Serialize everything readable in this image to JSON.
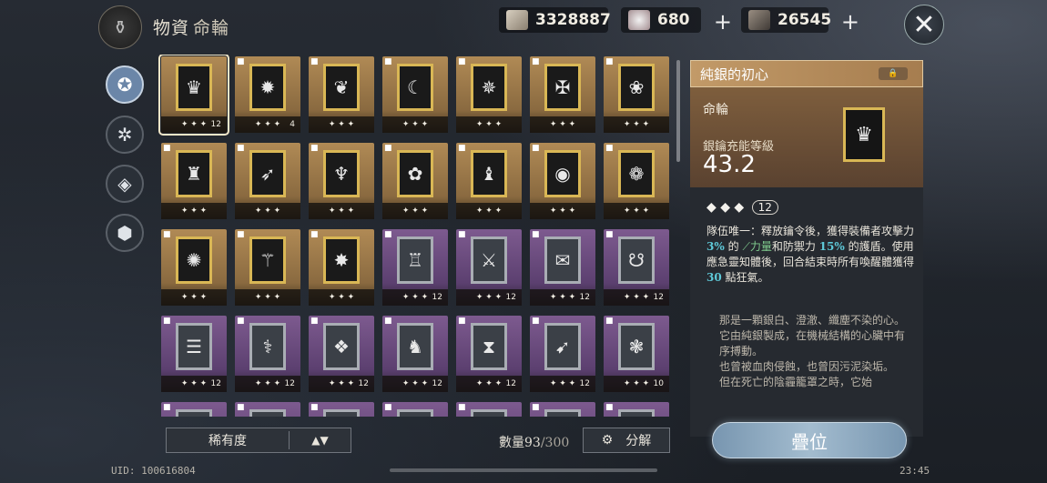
{
  "header": {
    "title": "物資",
    "subtitle": "命輪",
    "resources": [
      {
        "value": "3328887",
        "icon": "silver-ticket-icon"
      },
      {
        "value": "680",
        "icon": "feather-ore-icon"
      },
      {
        "value": "26545",
        "icon": "shard-icon"
      }
    ],
    "plus_glyph": "+",
    "close_glyph": "✕"
  },
  "nav": [
    {
      "glyph": "✪",
      "icon": "compass-icon"
    },
    {
      "glyph": "✲",
      "icon": "hexagon-icon"
    },
    {
      "glyph": "◈",
      "icon": "diamond-icon"
    },
    {
      "glyph": "⬢",
      "icon": "cube-icon"
    }
  ],
  "grid": {
    "items": [
      {
        "rarity": "gold",
        "glyph": "♛",
        "stars": "✦ ✦ ✦",
        "count": "12",
        "locked": false,
        "selected": true
      },
      {
        "rarity": "gold",
        "glyph": "✹",
        "stars": "✦ ✦ ✦",
        "count": "4",
        "locked": true
      },
      {
        "rarity": "gold",
        "glyph": "❦",
        "stars": "✦ ✦ ✦",
        "count": "",
        "locked": true
      },
      {
        "rarity": "gold",
        "glyph": "☾",
        "stars": "✦ ✦ ✦",
        "count": "",
        "locked": true
      },
      {
        "rarity": "gold",
        "glyph": "✵",
        "stars": "✦ ✦ ✦",
        "count": "",
        "locked": true
      },
      {
        "rarity": "gold",
        "glyph": "✠",
        "stars": "✦ ✦ ✦",
        "count": "",
        "locked": true
      },
      {
        "rarity": "gold",
        "glyph": "❀",
        "stars": "✦ ✦ ✦",
        "count": "",
        "locked": true
      },
      {
        "rarity": "gold",
        "glyph": "♜",
        "stars": "✦ ✦ ✦",
        "count": "",
        "locked": true
      },
      {
        "rarity": "gold",
        "glyph": "➶",
        "stars": "✦ ✦ ✦",
        "count": "",
        "locked": true
      },
      {
        "rarity": "gold",
        "glyph": "♆",
        "stars": "✦ ✦ ✦",
        "count": "",
        "locked": true
      },
      {
        "rarity": "gold",
        "glyph": "✿",
        "stars": "✦ ✦ ✦",
        "count": "",
        "locked": true
      },
      {
        "rarity": "gold",
        "glyph": "♝",
        "stars": "✦ ✦ ✦",
        "count": "",
        "locked": true
      },
      {
        "rarity": "gold",
        "glyph": "◉",
        "stars": "✦ ✦ ✦",
        "count": "",
        "locked": true
      },
      {
        "rarity": "gold",
        "glyph": "❁",
        "stars": "✦ ✦ ✦",
        "count": "",
        "locked": true
      },
      {
        "rarity": "gold",
        "glyph": "✺",
        "stars": "✦ ✦ ✦",
        "count": "",
        "locked": true
      },
      {
        "rarity": "gold",
        "glyph": "⚚",
        "stars": "✦ ✦ ✦",
        "count": "",
        "locked": true
      },
      {
        "rarity": "gold",
        "glyph": "✸",
        "stars": "✦ ✦ ✦",
        "count": "",
        "locked": true
      },
      {
        "rarity": "purple",
        "glyph": "♖",
        "stars": "✦ ✦ ✦",
        "count": "12",
        "locked": true
      },
      {
        "rarity": "purple",
        "glyph": "⚔",
        "stars": "✦ ✦ ✦",
        "count": "12",
        "locked": true
      },
      {
        "rarity": "purple",
        "glyph": "✉",
        "stars": "✦ ✦ ✦",
        "count": "12",
        "locked": true
      },
      {
        "rarity": "purple",
        "glyph": "☋",
        "stars": "✦ ✦ ✦",
        "count": "12",
        "locked": true
      },
      {
        "rarity": "purple",
        "glyph": "☰",
        "stars": "✦ ✦ ✦",
        "count": "12",
        "locked": true
      },
      {
        "rarity": "purple",
        "glyph": "⚕",
        "stars": "✦ ✦ ✦",
        "count": "12",
        "locked": true
      },
      {
        "rarity": "purple",
        "glyph": "❖",
        "stars": "✦ ✦ ✦",
        "count": "12",
        "locked": true
      },
      {
        "rarity": "purple",
        "glyph": "♞",
        "stars": "✦ ✦ ✦",
        "count": "12",
        "locked": true
      },
      {
        "rarity": "purple",
        "glyph": "⧗",
        "stars": "✦ ✦ ✦",
        "count": "12",
        "locked": true
      },
      {
        "rarity": "purple",
        "glyph": "➹",
        "stars": "✦ ✦ ✦",
        "count": "12",
        "locked": true
      },
      {
        "rarity": "purple",
        "glyph": "❃",
        "stars": "✦ ✦ ✦",
        "count": "10",
        "locked": true
      },
      {
        "rarity": "purple",
        "glyph": "",
        "stars": "",
        "count": "",
        "locked": true
      },
      {
        "rarity": "purple",
        "glyph": "",
        "stars": "",
        "count": "",
        "locked": true
      },
      {
        "rarity": "purple",
        "glyph": "",
        "stars": "",
        "count": "",
        "locked": true
      },
      {
        "rarity": "purple",
        "glyph": "",
        "stars": "",
        "count": "",
        "locked": true
      },
      {
        "rarity": "purple",
        "glyph": "",
        "stars": "",
        "count": "",
        "locked": true
      },
      {
        "rarity": "purple",
        "glyph": "",
        "stars": "",
        "count": "",
        "locked": true
      },
      {
        "rarity": "purple",
        "glyph": "",
        "stars": "",
        "count": "",
        "locked": true
      }
    ]
  },
  "detail": {
    "name": "純銀的初心",
    "type": "命輪",
    "stat_label": "銀鑰充能等級",
    "stat_value": "43.2",
    "stars": "◆ ◆ ◆",
    "level": "12",
    "desc_1": "隊伍唯一：釋放鑰令後，獲得裝備者攻擊力",
    "desc_hl1": "3%",
    "desc_2": "的",
    "desc_tag": "⟋力量",
    "desc_3": "和防禦力",
    "desc_hl2": "15%",
    "desc_4": "的護盾。使用應急靈知體後，回合結束時所有喚醒體獲得",
    "desc_hl3": "30",
    "desc_5": "點狂氣。",
    "flavor": "那是一顆銀白、澄澈、纖塵不染的心。\n它由純銀製成，在機械結構的心臟中有序搏動。\n也曾被血肉侵蝕，也曾因污泥染垢。\n但在死亡的陰霾籠罩之時，它始"
  },
  "footer": {
    "sort_label": "稀有度",
    "sort_arrows": "▲▼",
    "qty_label": "數量",
    "qty_value": "93",
    "qty_total": "/300",
    "decompose": "分解",
    "stack": "疊位",
    "uid": "UID: 100616804",
    "time": "23:45"
  }
}
